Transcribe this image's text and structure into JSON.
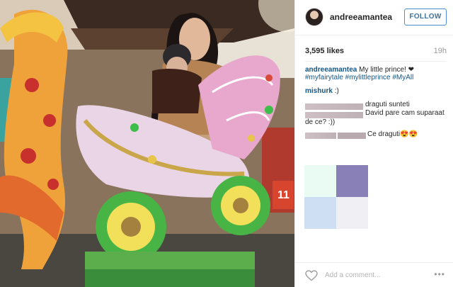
{
  "post": {
    "username": "andreeamantea",
    "follow_label": "FOLLOW",
    "likes": "3,595 likes",
    "time_ago": "19h"
  },
  "comments": [
    {
      "author": "andreeamantea",
      "text": "My little prince! ❤"
    },
    {
      "tags": "#myfairytale #mylittleprince #MyAll"
    },
    {
      "author": "mishurk",
      "text": ":)"
    },
    {
      "text": "draguti sunteti"
    },
    {
      "text": "David pare cam suparaat"
    },
    {
      "text": "de ce? :))"
    },
    {
      "text": "Ce draguti😍😍"
    }
  ],
  "swatches": [
    "#e9fbf3",
    "#8a80b8",
    "#cfdff3",
    "#f0f0f4"
  ],
  "footer": {
    "comment_placeholder": "Add a comment...",
    "more_label": "•••"
  },
  "icons": {
    "heart": "heart-icon",
    "more": "more-options-icon"
  },
  "colors": {
    "link": "#125688",
    "follow_border": "#4f8bd3",
    "follow_text": "#3f729b"
  }
}
